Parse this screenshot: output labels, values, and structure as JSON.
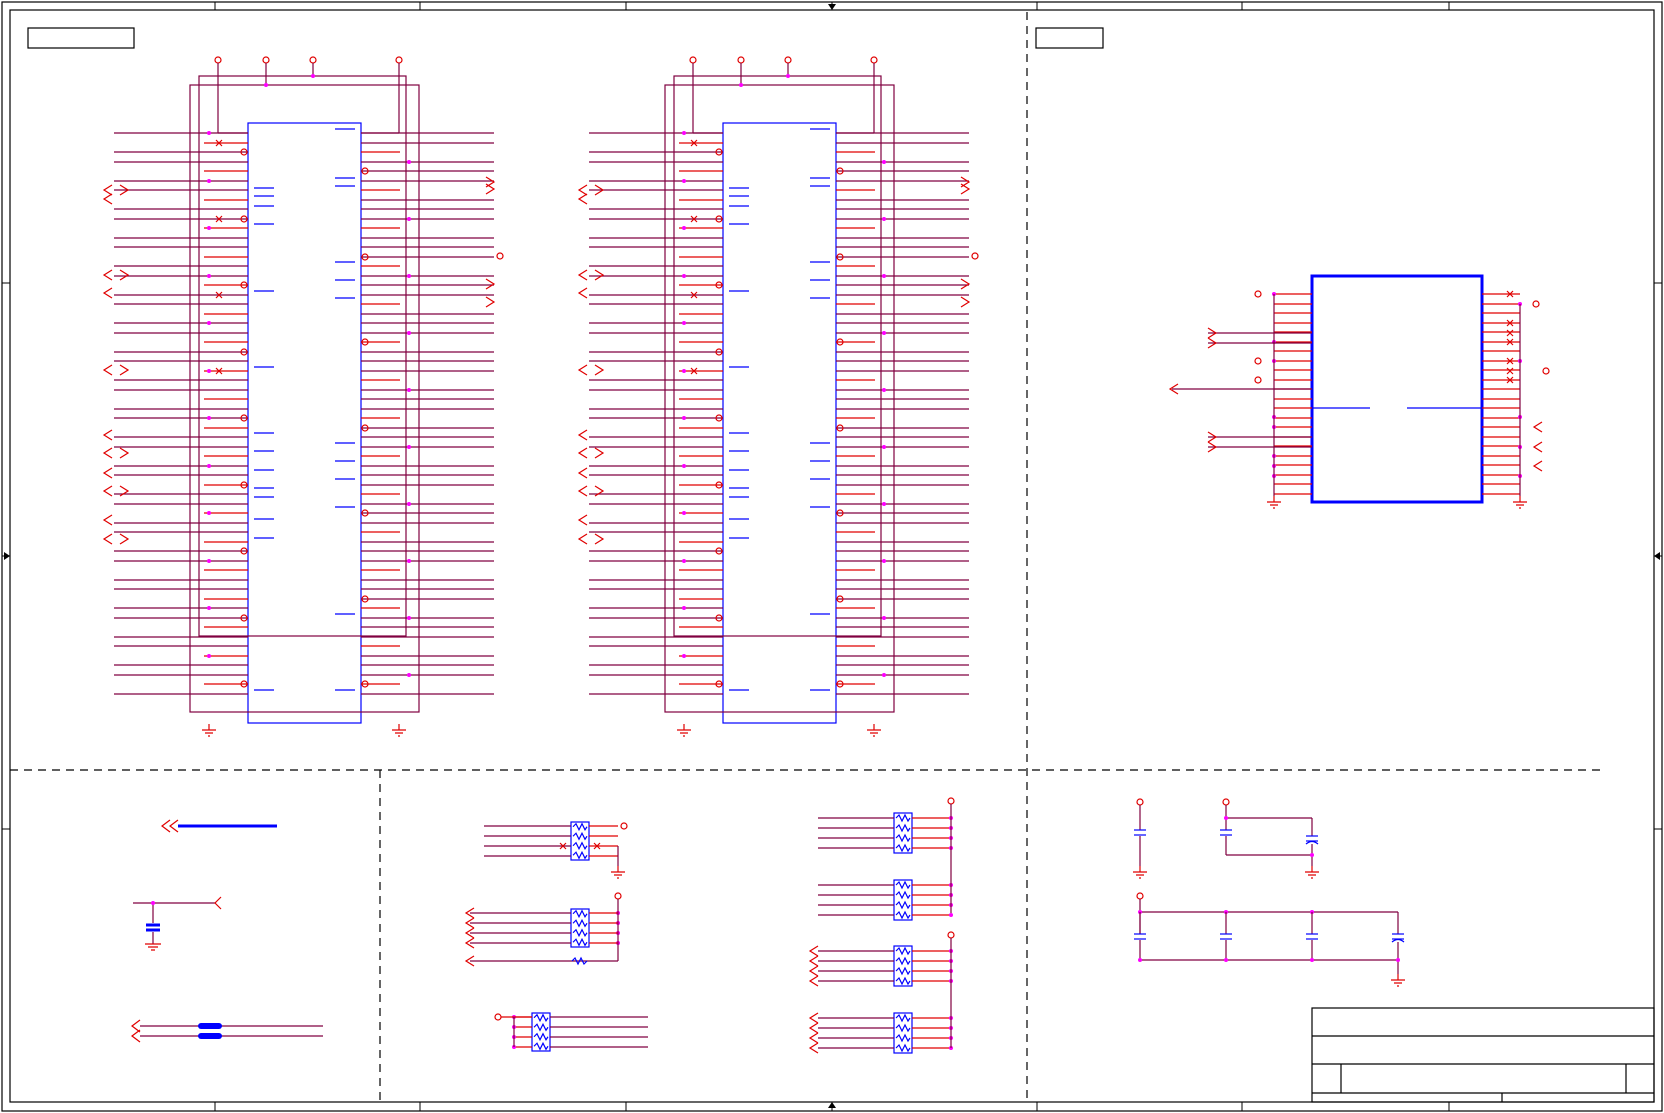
{
  "diagram": {
    "type": "electrical-schematic",
    "blocks": [
      {
        "id": "connector-a",
        "kind": "multi-pin connector"
      },
      {
        "id": "connector-b",
        "kind": "multi-pin connector"
      },
      {
        "id": "ic-u1",
        "kind": "integrated circuit"
      },
      {
        "id": "resistor-networks",
        "kind": "resistor arrays"
      },
      {
        "id": "decoupling-caps",
        "kind": "capacitors"
      },
      {
        "id": "title-block",
        "kind": "title block"
      }
    ],
    "labels": {}
  },
  "colors": {
    "wire": "#800040",
    "pin": "#e00000",
    "component_body": "#0000ff",
    "junction": "#ff00ff",
    "frame": "#000000"
  }
}
